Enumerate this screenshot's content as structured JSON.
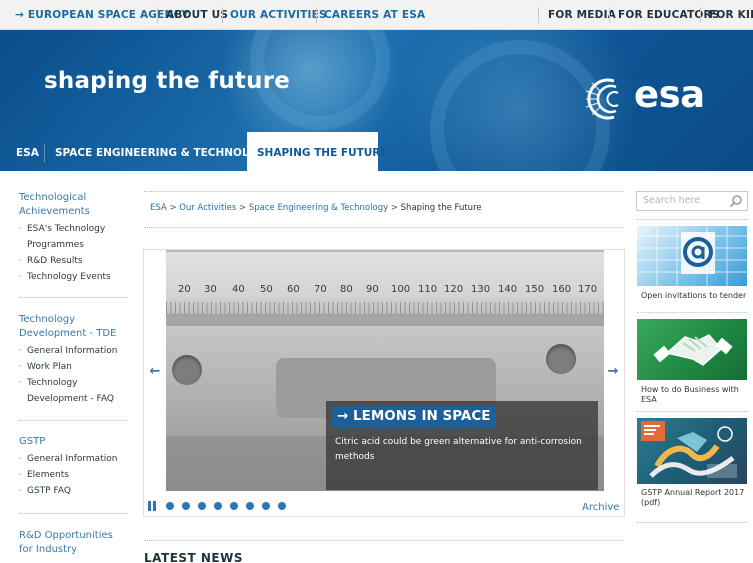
{
  "topnav": {
    "esa": "→ EUROPEAN SPACE AGENCY",
    "about": "ABOUT US",
    "activities": "OUR ACTIVITIES",
    "careers": "CAREERS AT ESA",
    "media": "FOR MEDIA",
    "educators": "FOR EDUCATORS",
    "kids": "FOR KIDS"
  },
  "banner": {
    "title": "shaping the future",
    "logo_word": "esa"
  },
  "tabs": [
    "ESA",
    "SPACE ENGINEERING & TECHNOLOGY",
    "SHAPING THE FUTURE"
  ],
  "sidebar": {
    "group1": {
      "head": "Technological Achievements",
      "items": [
        "ESA's Technology Programmes",
        "R&D Results",
        "Technology Events"
      ]
    },
    "group2": {
      "head": "Technology Development - TDE",
      "items": [
        "General Information",
        "Work Plan",
        "Technology Development - FAQ"
      ]
    },
    "group3": {
      "head": "GSTP",
      "items": [
        "General Information",
        "Elements",
        "GSTP FAQ"
      ]
    },
    "group4": {
      "head": "R&D Opportunities for Industry"
    }
  },
  "breadcrumb": {
    "items": [
      "ESA",
      "Our Activities",
      "Space Engineering & Technology",
      "Shaping the Future"
    ],
    "separator": ">"
  },
  "carousel": {
    "ruler_numbers": [
      "20",
      "30",
      "40",
      "50",
      "60",
      "70",
      "80",
      "90",
      "100",
      "110",
      "120",
      "130",
      "140",
      "150",
      "160",
      "170"
    ],
    "title": "→ LEMONS IN SPACE",
    "text": "Citric acid could be green alternative for anti-corrosion methods",
    "prev": "←",
    "next": "→",
    "slide_count": 8,
    "archive": "Archive"
  },
  "latest_news": "LATEST NEWS",
  "search": {
    "placeholder": "Search here"
  },
  "promos": [
    {
      "label": "Open invitations to tender"
    },
    {
      "label": "How to do Business with ESA"
    },
    {
      "label": "GSTP Annual Report 2017 (pdf)"
    }
  ],
  "colors": {
    "brand_blue": "#1d5f98",
    "link_blue": "#2f76ae",
    "banner_blue": "#0e5595",
    "nav_bg": "#f2f2f2"
  }
}
